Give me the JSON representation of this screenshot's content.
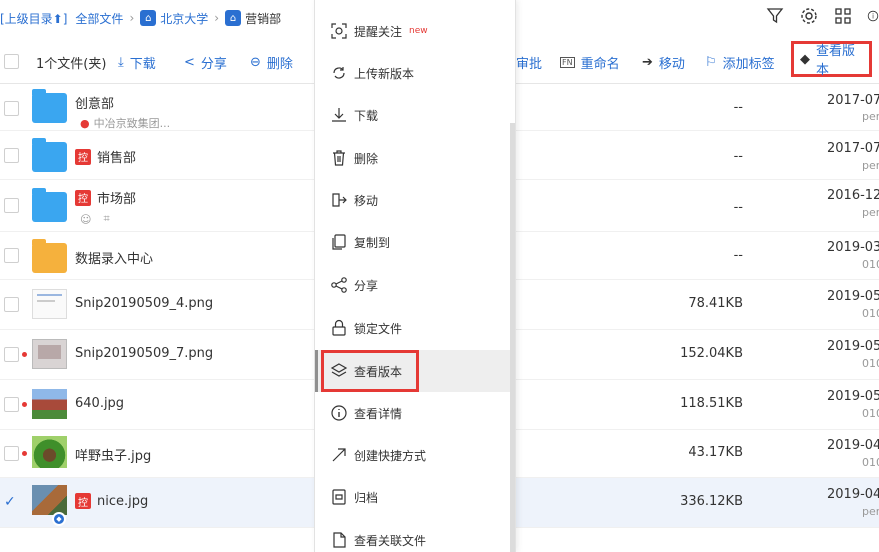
{
  "breadcrumb": {
    "up": "[上级目录⬆]",
    "all": "全部文件",
    "lib_icon": "library-icon",
    "lib": "北京大学",
    "current": "营销部"
  },
  "toolbar": {
    "count": "1个文件(夹)",
    "download": "下载",
    "share": "分享",
    "delete": "删除",
    "approve_partial": "审批",
    "rename": "重命名",
    "move": "移动",
    "add_tag": "添加标签",
    "view_version": "查看版本"
  },
  "rows": [
    {
      "name": "创意部",
      "sub": "中冶京致集团...",
      "size": "--",
      "date": "2017-07-",
      "who": "per"
    },
    {
      "name": "销售部",
      "badge": "控",
      "size": "--",
      "date": "2017-07-",
      "who": "per"
    },
    {
      "name": "市场部",
      "badge": "控",
      "size": "--",
      "date": "2016-12-",
      "who": "per"
    },
    {
      "name": "数据录入中心",
      "size": "--",
      "date": "2019-03-",
      "who": "010"
    },
    {
      "name": "Snip20190509_4.png",
      "size": "78.41KB",
      "date": "2019-05-",
      "who": "010"
    },
    {
      "name": "Snip20190509_7.png",
      "size": "152.04KB",
      "date": "2019-05-",
      "who": "010"
    },
    {
      "name": "640.jpg",
      "size": "118.51KB",
      "date": "2019-05-",
      "who": "010"
    },
    {
      "name": "咩野虫子.jpg",
      "size": "43.17KB",
      "date": "2019-04-",
      "who": "010"
    },
    {
      "name": "nice.jpg",
      "badge": "控",
      "size": "336.12KB",
      "date": "2019-04-",
      "who": "per"
    }
  ],
  "menu": {
    "items": [
      {
        "label": "提醒关注",
        "sup": "new",
        "icon": "bell-scan-icon"
      },
      {
        "label": "上传新版本",
        "icon": "upload-version-icon"
      },
      {
        "label": "下载",
        "icon": "download-icon"
      },
      {
        "label": "删除",
        "icon": "trash-icon"
      },
      {
        "label": "移动",
        "icon": "move-icon"
      },
      {
        "label": "复制到",
        "icon": "copy-icon"
      },
      {
        "label": "分享",
        "icon": "share-icon"
      },
      {
        "label": "锁定文件",
        "icon": "lock-icon"
      },
      {
        "label": "查看版本",
        "icon": "layers-icon"
      },
      {
        "label": "查看详情",
        "icon": "info-icon"
      },
      {
        "label": "创建快捷方式",
        "icon": "shortcut-arrow-icon"
      },
      {
        "label": "归档",
        "icon": "archive-icon"
      },
      {
        "label": "查看关联文件",
        "icon": "linked-file-icon"
      }
    ]
  },
  "colors": {
    "accent": "#2a6fd1",
    "highlight_box": "#e53935"
  }
}
